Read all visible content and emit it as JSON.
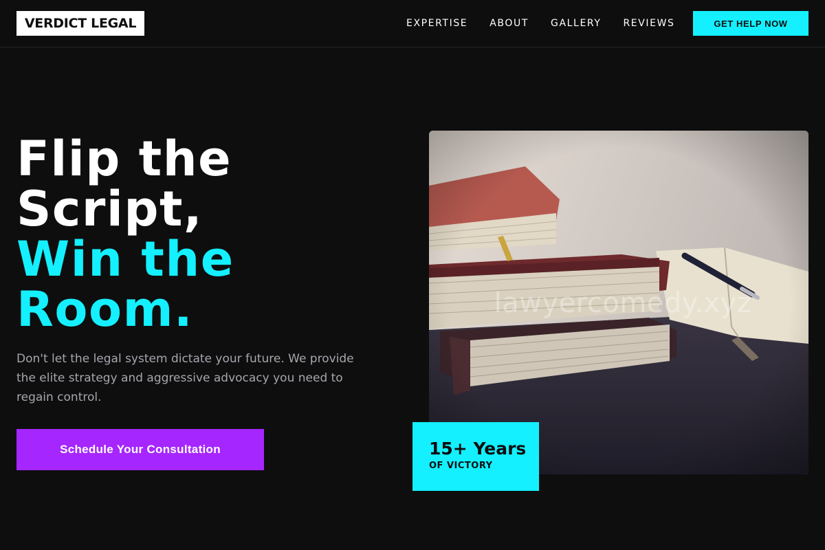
{
  "header": {
    "logo": "VERDICT LEGAL",
    "nav": [
      "EXPERTISE",
      "ABOUT",
      "GALLERY",
      "REVIEWS"
    ],
    "cta": "GET HELP NOW"
  },
  "hero": {
    "title_line1": "Flip the",
    "title_line2": "Script,",
    "accent_line1": "Win the",
    "accent_line2": "Room.",
    "description": "Don't let the legal system dictate your future. We provide the elite strategy and aggressive advocacy you need to regain control.",
    "cta": "Schedule Your Consultation"
  },
  "photo": {
    "subject": "stack-of-law-books-with-pen-icon",
    "watermark": "lawyercomedy.xyz"
  },
  "badge": {
    "value": "15+ Years",
    "label": "OF VICTORY"
  },
  "colors": {
    "background": "#0e0e0f",
    "accent": "#14f0ff",
    "cta_purple": "#a626ff",
    "muted_text": "#a6a6ad"
  }
}
